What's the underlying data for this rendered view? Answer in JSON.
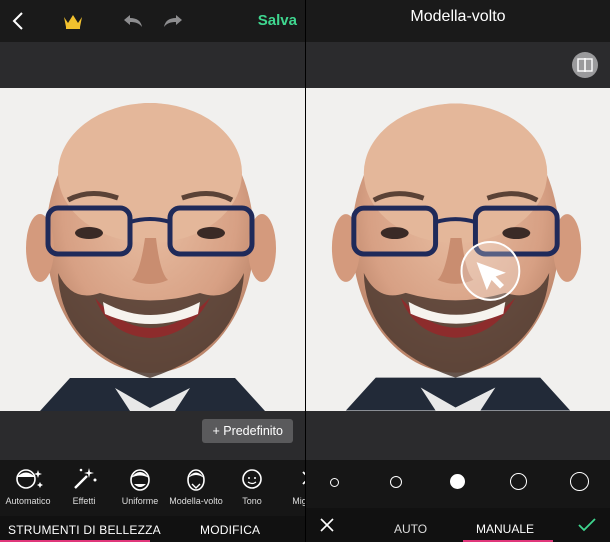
{
  "left": {
    "toolbar": {
      "back_icon": "chevron-left-icon",
      "crown_icon": "crown-icon",
      "undo_icon": "undo-icon",
      "redo_icon": "redo-icon",
      "save_label": "Salva"
    },
    "preset_button": "+ Predefinito",
    "tools": [
      {
        "label": "Automatico",
        "icon": "auto-face-icon"
      },
      {
        "label": "Effetti",
        "icon": "magic-wand-icon"
      },
      {
        "label": "Uniforme",
        "icon": "smooth-face-icon"
      },
      {
        "label": "Modella-volto",
        "icon": "reshape-face-icon"
      },
      {
        "label": "Tono",
        "icon": "tone-face-icon"
      },
      {
        "label": "Migliora",
        "icon": "enhance-icon"
      }
    ],
    "bottom_tabs": {
      "beauty": "STRUMENTI DI BELLEZZA",
      "edit": "MODIFICA"
    }
  },
  "right": {
    "title": "Modella-volto",
    "brush_sizes": [
      "size-1",
      "size-2",
      "size-3",
      "size-4",
      "size-5"
    ],
    "selected_size": 3,
    "bottom": {
      "auto": "AUTO",
      "manual": "MANUALE"
    }
  },
  "colors": {
    "accent_green": "#3fd68f",
    "accent_pink": "#e0367a",
    "crown_gold": "#f2c12e"
  }
}
